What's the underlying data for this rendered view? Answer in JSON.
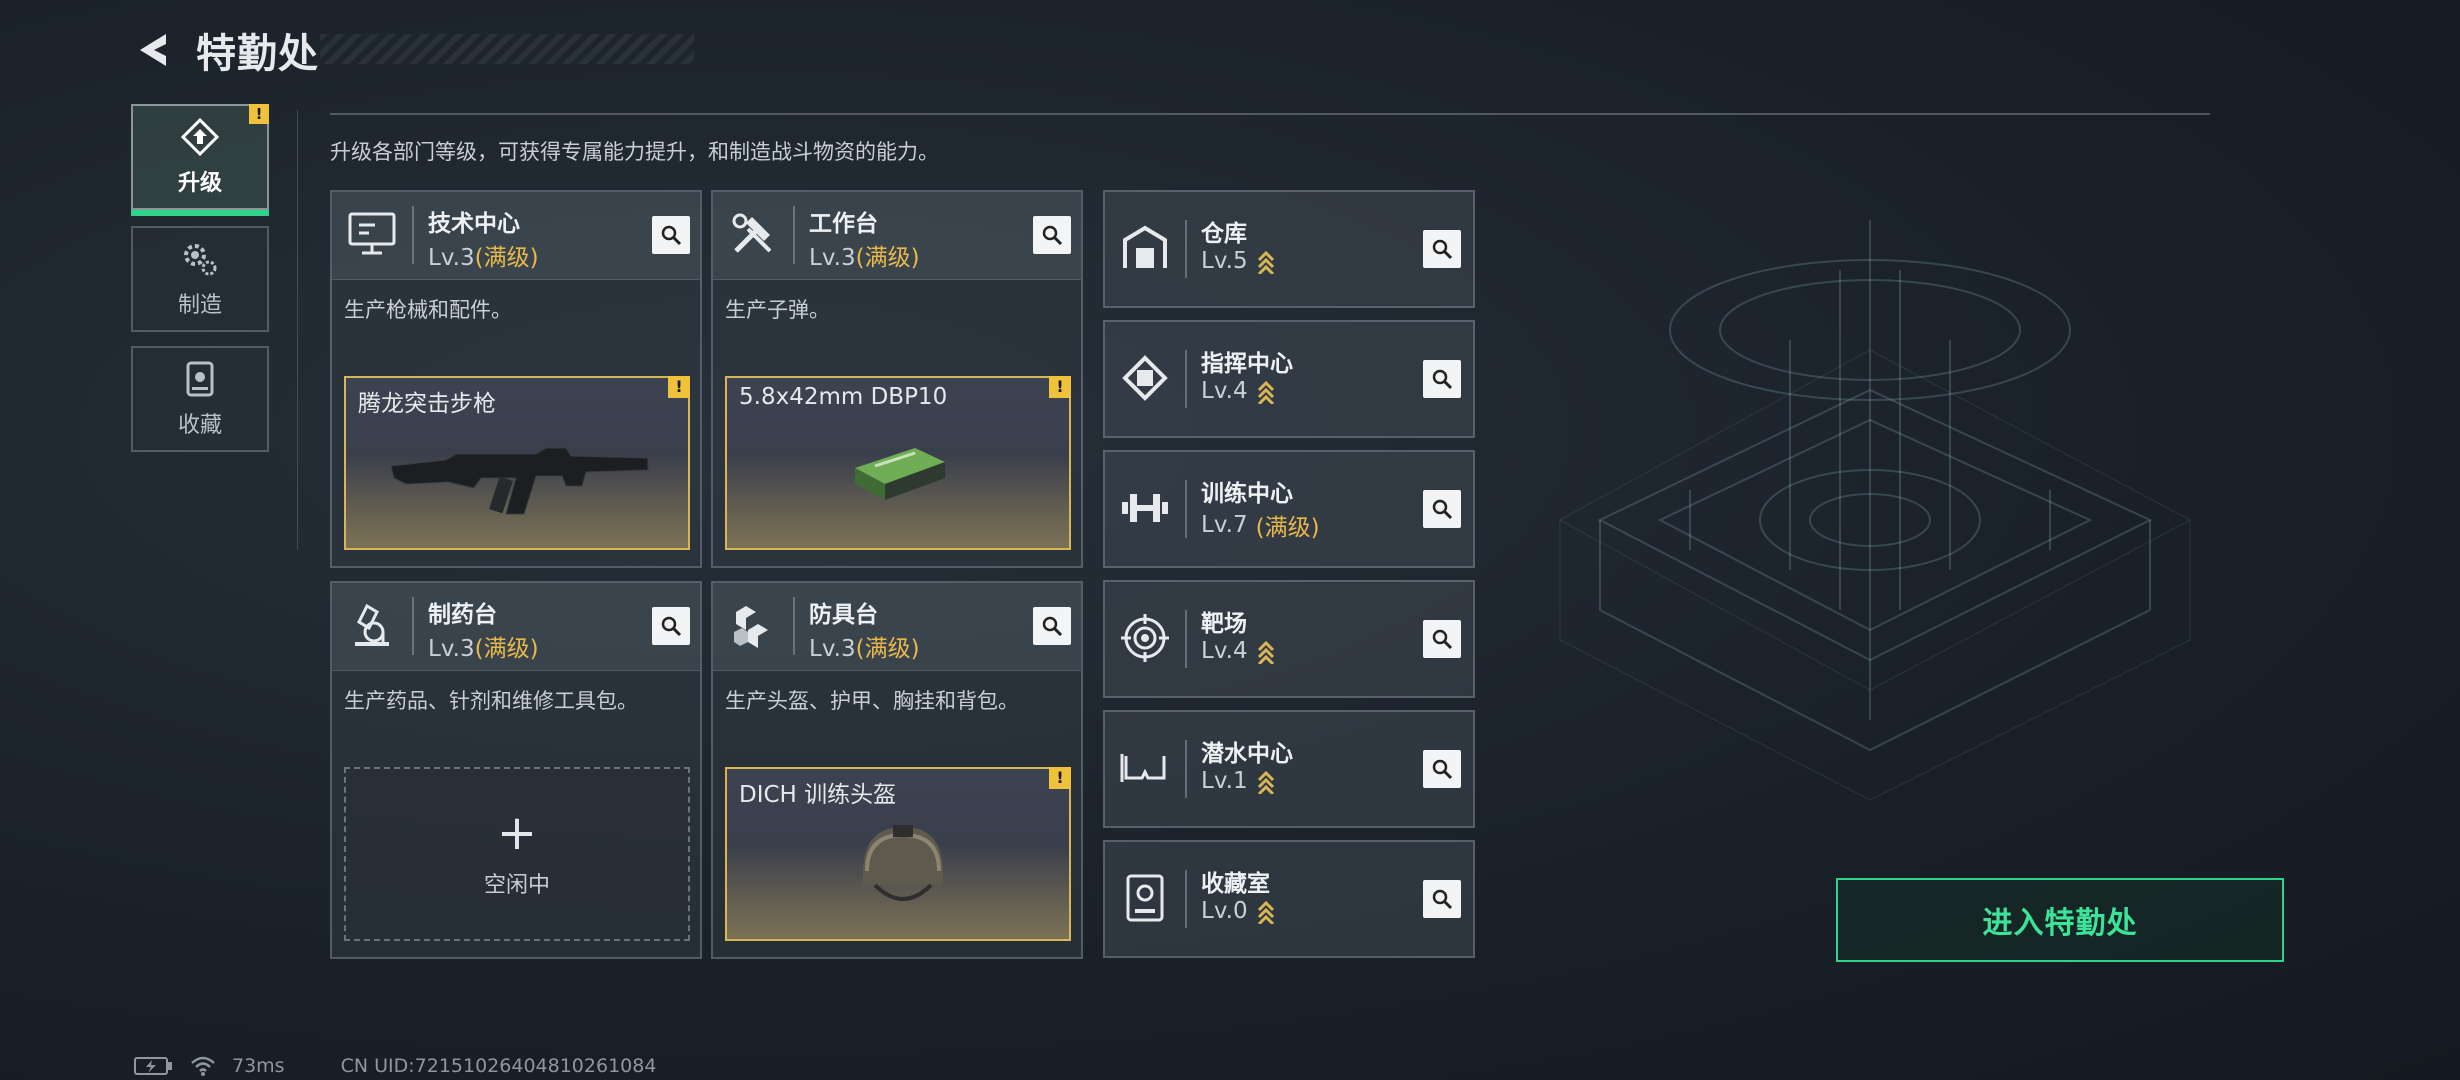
{
  "header": {
    "title": "特勤处"
  },
  "tabs": [
    {
      "label": "升级",
      "icon": "upgrade-icon",
      "active": true,
      "badge": "!"
    },
    {
      "label": "制造",
      "icon": "gears-icon",
      "active": false
    },
    {
      "label": "收藏",
      "icon": "collection-icon",
      "active": false
    }
  ],
  "description": "升级各部门等级，可获得专属能力提升，和制造战斗物资的能力。",
  "big_cards": [
    {
      "name": "技术中心",
      "level": "Lv.3",
      "max": "(满级)",
      "desc": "生产枪械和配件。",
      "icon": "monitor-icon",
      "slot": {
        "item": "腾龙突击步枪",
        "badge": "!"
      }
    },
    {
      "name": "工作台",
      "level": "Lv.3",
      "max": "(满级)",
      "desc": "生产子弹。",
      "icon": "tools-icon",
      "slot": {
        "item": "5.8x42mm DBP10",
        "badge": "!"
      }
    },
    {
      "name": "制药台",
      "level": "Lv.3",
      "max": "(满级)",
      "desc": "生产药品、针剂和维修工具包。",
      "icon": "microscope-icon",
      "slot": {
        "empty_label": "空闲中",
        "plus": "+"
      }
    },
    {
      "name": "防具台",
      "level": "Lv.3",
      "max": "(满级)",
      "desc": "生产头盔、护甲、胸挂和背包。",
      "icon": "boxes-icon",
      "slot": {
        "item": "DICH 训练头盔",
        "badge": "!"
      }
    }
  ],
  "small_cards": [
    {
      "name": "仓库",
      "level": "Lv.5",
      "icon": "warehouse-icon",
      "upgradable": true
    },
    {
      "name": "指挥中心",
      "level": "Lv.4",
      "icon": "chip-icon",
      "upgradable": true
    },
    {
      "name": "训练中心",
      "level": "Lv.7",
      "max": "(满级)",
      "icon": "dumbbell-icon",
      "upgradable": false
    },
    {
      "name": "靶场",
      "level": "Lv.4",
      "icon": "target-icon",
      "upgradable": true
    },
    {
      "name": "潜水中心",
      "level": "Lv.1",
      "icon": "goggles-icon",
      "upgradable": true
    },
    {
      "name": "收藏室",
      "level": "Lv.0",
      "icon": "trophy-case-icon",
      "upgradable": true
    }
  ],
  "enter_button": "进入特勤处",
  "footer": {
    "ping": "73ms",
    "uid": "CN UID:72151026404810261084"
  },
  "colors": {
    "accent_green": "#2fd38a",
    "max_level": "#e9b94a",
    "badge": "#f0c23b"
  }
}
